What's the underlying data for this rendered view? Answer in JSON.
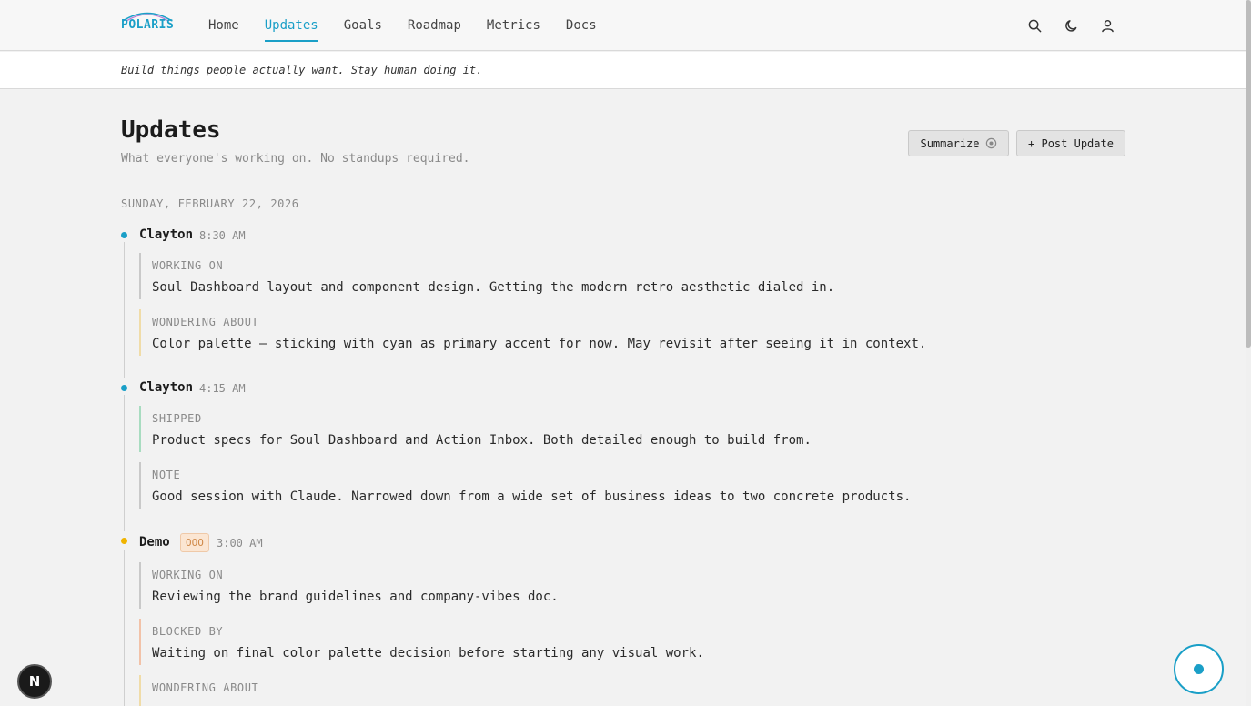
{
  "brand": {
    "logo_text": "POLARIS",
    "accent_color": "#1a9fc7"
  },
  "nav": {
    "links": [
      {
        "label": "Home",
        "active": false
      },
      {
        "label": "Updates",
        "active": true
      },
      {
        "label": "Goals",
        "active": false
      },
      {
        "label": "Roadmap",
        "active": false
      },
      {
        "label": "Metrics",
        "active": false
      },
      {
        "label": "Docs",
        "active": false
      }
    ],
    "icons": [
      "search-icon",
      "moon-icon",
      "user-icon"
    ]
  },
  "tagline": "Build things people actually want. Stay human doing it.",
  "page": {
    "title": "Updates",
    "subtitle": "What everyone's working on. No standups required."
  },
  "actions": {
    "summarize_label": "Summarize",
    "post_label": "+ Post Update"
  },
  "feed": {
    "date": "SUNDAY, FEBRUARY 22, 2026",
    "entries": [
      {
        "name": "Clayton",
        "time": "8:30 AM",
        "dot_color": "#1a9fc7",
        "blocks": [
          {
            "label": "WORKING ON",
            "text": "Soul Dashboard layout and component design. Getting the modern retro aesthetic dialed in.",
            "color": "#c9c9c9"
          },
          {
            "label": "WONDERING ABOUT",
            "text": "Color palette — sticking with cyan as primary accent for now. May revisit after seeing it in context.",
            "color": "#f0dca8"
          }
        ]
      },
      {
        "name": "Clayton",
        "time": "4:15 AM",
        "dot_color": "#1a9fc7",
        "blocks": [
          {
            "label": "SHIPPED",
            "text": "Product specs for Soul Dashboard and Action Inbox. Both detailed enough to build from.",
            "color": "#a8dcc0"
          },
          {
            "label": "NOTE",
            "text": "Good session with Claude. Narrowed down from a wide set of business ideas to two concrete products.",
            "color": "#c9c9c9"
          }
        ]
      },
      {
        "name": "Demo",
        "tag": "OOO",
        "time": "3:00 AM",
        "dot_color": "#f0b400",
        "blocks": [
          {
            "label": "WORKING ON",
            "text": "Reviewing the brand guidelines and company-vibes doc.",
            "color": "#c9c9c9"
          },
          {
            "label": "BLOCKED BY",
            "text": "Waiting on final color palette decision before starting any visual work.",
            "color": "#f2c2a8"
          },
          {
            "label": "WONDERING ABOUT",
            "text": "",
            "color": "#f0dca8"
          }
        ]
      }
    ]
  },
  "widgets": {
    "fab_icon": "record-dot-icon",
    "framework_badge": "N"
  }
}
